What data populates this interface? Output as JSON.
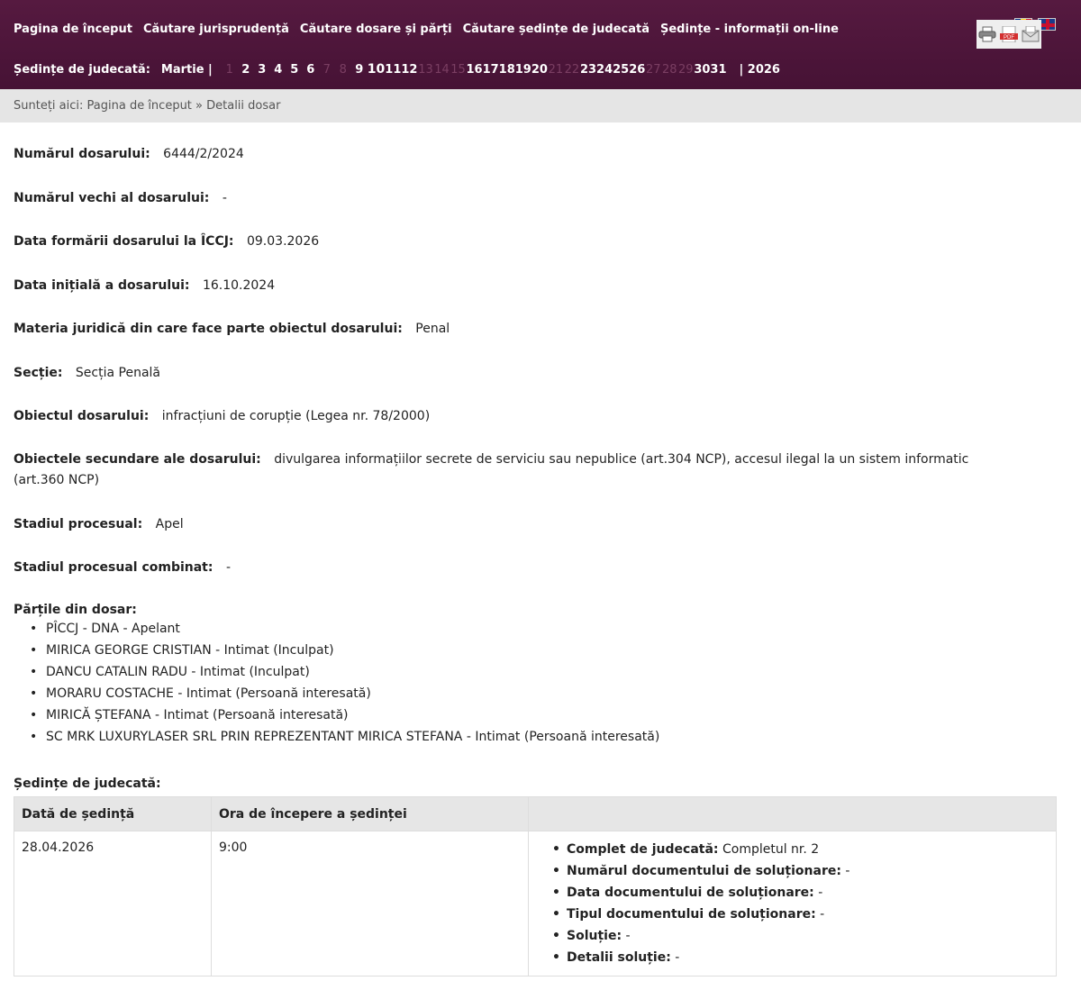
{
  "nav": {
    "items": [
      "Pagina de început",
      "Căutare jurisprudență",
      "Căutare dosare și părți",
      "Căutare ședințe de judecată",
      "Ședințe - informații on-line"
    ]
  },
  "flags": {
    "ro": "romania-flag-icon",
    "uk": "uk-flag-icon"
  },
  "calendar": {
    "label": "Ședințe de judecată:",
    "month": "Martie |",
    "days": [
      {
        "n": "1",
        "dim": true
      },
      {
        "n": "2",
        "dim": false
      },
      {
        "n": "3",
        "dim": false
      },
      {
        "n": "4",
        "dim": false
      },
      {
        "n": "5",
        "dim": false
      },
      {
        "n": "6",
        "dim": false
      },
      {
        "n": "7",
        "dim": true
      },
      {
        "n": "8",
        "dim": true
      },
      {
        "n": "9",
        "dim": false
      },
      {
        "n": "10",
        "dim": false
      },
      {
        "n": "11",
        "dim": false
      },
      {
        "n": "12",
        "dim": false
      },
      {
        "n": "13",
        "dim": true
      },
      {
        "n": "14",
        "dim": true
      },
      {
        "n": "15",
        "dim": true
      },
      {
        "n": "16",
        "dim": false
      },
      {
        "n": "17",
        "dim": false
      },
      {
        "n": "18",
        "dim": false
      },
      {
        "n": "19",
        "dim": false
      },
      {
        "n": "20",
        "dim": false
      },
      {
        "n": "21",
        "dim": true
      },
      {
        "n": "22",
        "dim": true
      },
      {
        "n": "23",
        "dim": false
      },
      {
        "n": "24",
        "dim": false
      },
      {
        "n": "25",
        "dim": false
      },
      {
        "n": "26",
        "dim": false
      },
      {
        "n": "27",
        "dim": true
      },
      {
        "n": "28",
        "dim": true
      },
      {
        "n": "29",
        "dim": true
      },
      {
        "n": "30",
        "dim": false
      },
      {
        "n": "31",
        "dim": false
      }
    ],
    "year": "| 2026"
  },
  "breadcrumb": "Sunteți aici: Pagina de început » Detalii dosar",
  "tools": [
    "print-icon",
    "pdf-icon",
    "email-icon"
  ],
  "fields": [
    {
      "k": "Numărul dosarului:",
      "v": "6444/2/2024"
    },
    {
      "k": "Numărul vechi al dosarului:",
      "v": "-"
    },
    {
      "k": "Data formării dosarului la ÎCCJ:",
      "v": "09.03.2026"
    },
    {
      "k": "Data inițială a dosarului:",
      "v": "16.10.2024"
    },
    {
      "k": "Materia juridică din care face parte obiectul dosarului:",
      "v": "Penal"
    },
    {
      "k": "Secție:",
      "v": "Secția Penală"
    },
    {
      "k": "Obiectul dosarului:",
      "v": "infracțiuni de corupție (Legea nr. 78/2000)"
    },
    {
      "k": "Obiectele secundare ale dosarului:",
      "v": "divulgarea informațiilor secrete de serviciu sau nepublice (art.304 NCP), accesul ilegal la un sistem informatic (art.360 NCP)"
    },
    {
      "k": "Stadiul procesual:",
      "v": "Apel"
    },
    {
      "k": "Stadiul procesual combinat:",
      "v": "-"
    }
  ],
  "parties": {
    "title": "Părțile din dosar:",
    "items": [
      "PÎCCJ - DNA - Apelant",
      "MIRICA GEORGE CRISTIAN - Intimat (Inculpat)",
      "DANCU CATALIN RADU - Intimat (Inculpat)",
      "MORARU COSTACHE - Intimat (Persoană interesată)",
      "MIRICĂ ȘTEFANA - Intimat (Persoană interesată)",
      "SC MRK LUXURYLASER SRL PRIN REPREZENTANT MIRICA STEFANA - Intimat (Persoană interesată)"
    ]
  },
  "sessions": {
    "title": "Ședințe de judecată:",
    "headers": [
      "Dată de ședință",
      "Ora de începere a ședinței",
      ""
    ],
    "rows": [
      {
        "date": "28.04.2026",
        "time": "9:00",
        "details": [
          {
            "k": "Complet de judecată:",
            "v": "Completul nr. 2"
          },
          {
            "k": "Numărul documentului de soluționare:",
            "v": "-"
          },
          {
            "k": "Data documentului de soluționare:",
            "v": "-"
          },
          {
            "k": "Tipul documentului de soluționare:",
            "v": "-"
          },
          {
            "k": "Soluție:",
            "v": "-"
          },
          {
            "k": "Detalii soluție:",
            "v": "-"
          }
        ]
      }
    ]
  }
}
